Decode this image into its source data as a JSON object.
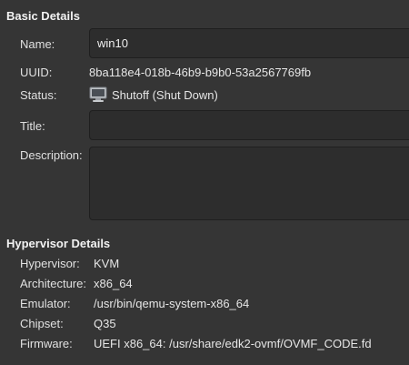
{
  "basic": {
    "title": "Basic Details",
    "name_label": "Name:",
    "name_value": "win10",
    "uuid_label": "UUID:",
    "uuid_value": "8ba118e4-018b-46b9-b9b0-53a2567769fb",
    "status_label": "Status:",
    "status_icon": "monitor-icon",
    "status_value": "Shutoff (Shut Down)",
    "title_label": "Title:",
    "title_value": "",
    "description_label": "Description:",
    "description_value": ""
  },
  "hypervisor": {
    "title": "Hypervisor Details",
    "hypervisor_label": "Hypervisor:",
    "hypervisor_value": "KVM",
    "architecture_label": "Architecture:",
    "architecture_value": "x86_64",
    "emulator_label": "Emulator:",
    "emulator_value": "/usr/bin/qemu-system-x86_64",
    "chipset_label": "Chipset:",
    "chipset_value": "Q35",
    "firmware_label": "Firmware:",
    "firmware_value": "UEFI x86_64: /usr/share/edk2-ovmf/OVMF_CODE.fd"
  }
}
